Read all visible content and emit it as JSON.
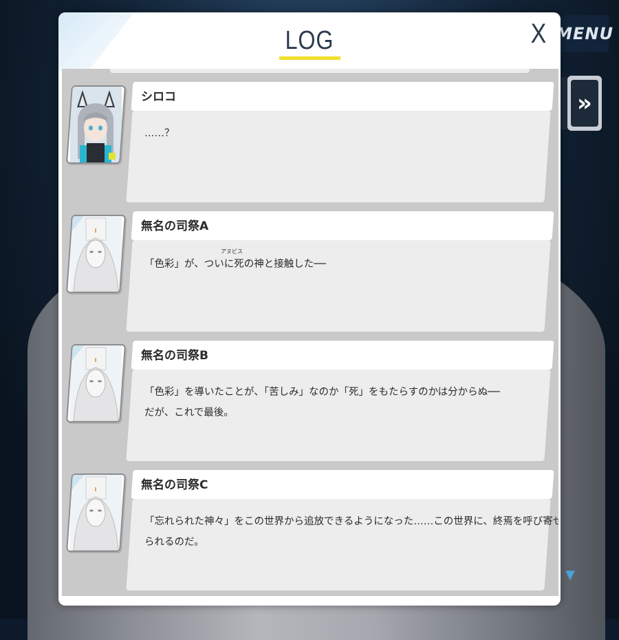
{
  "header": {
    "title": "LOG",
    "close_label": "X"
  },
  "background": {
    "menu_label": "MENU",
    "skip_label": "»",
    "scroll_arrow": "▼"
  },
  "entries": [
    {
      "name": "シロコ",
      "avatar_icon": "shiroko-portrait-icon",
      "lines": [
        "……？"
      ]
    },
    {
      "name": "無名の司祭A",
      "avatar_icon": "masked-priest-portrait-icon",
      "lines": [
        "「色彩」が、ついに死の神と接触した──"
      ],
      "ruby": "アヌビス"
    },
    {
      "name": "無名の司祭B",
      "avatar_icon": "masked-priest-portrait-icon",
      "lines": [
        "「色彩」を導いたことが、「苦しみ」なのか「死」をもたらすのかは分からぬ──",
        "だが、これで最後。"
      ]
    },
    {
      "name": "無名の司祭C",
      "avatar_icon": "masked-priest-portrait-icon",
      "lines": [
        "「忘れられた神々」をこの世界から追放できるようになった……この世界に、終焉を呼び寄せ",
        "られるのだ。"
      ]
    }
  ],
  "colors": {
    "accent_underline": "#f2e02a",
    "title_text": "#2b3a4e",
    "list_bg": "#c9c9c9",
    "message_bg": "#ededed"
  }
}
